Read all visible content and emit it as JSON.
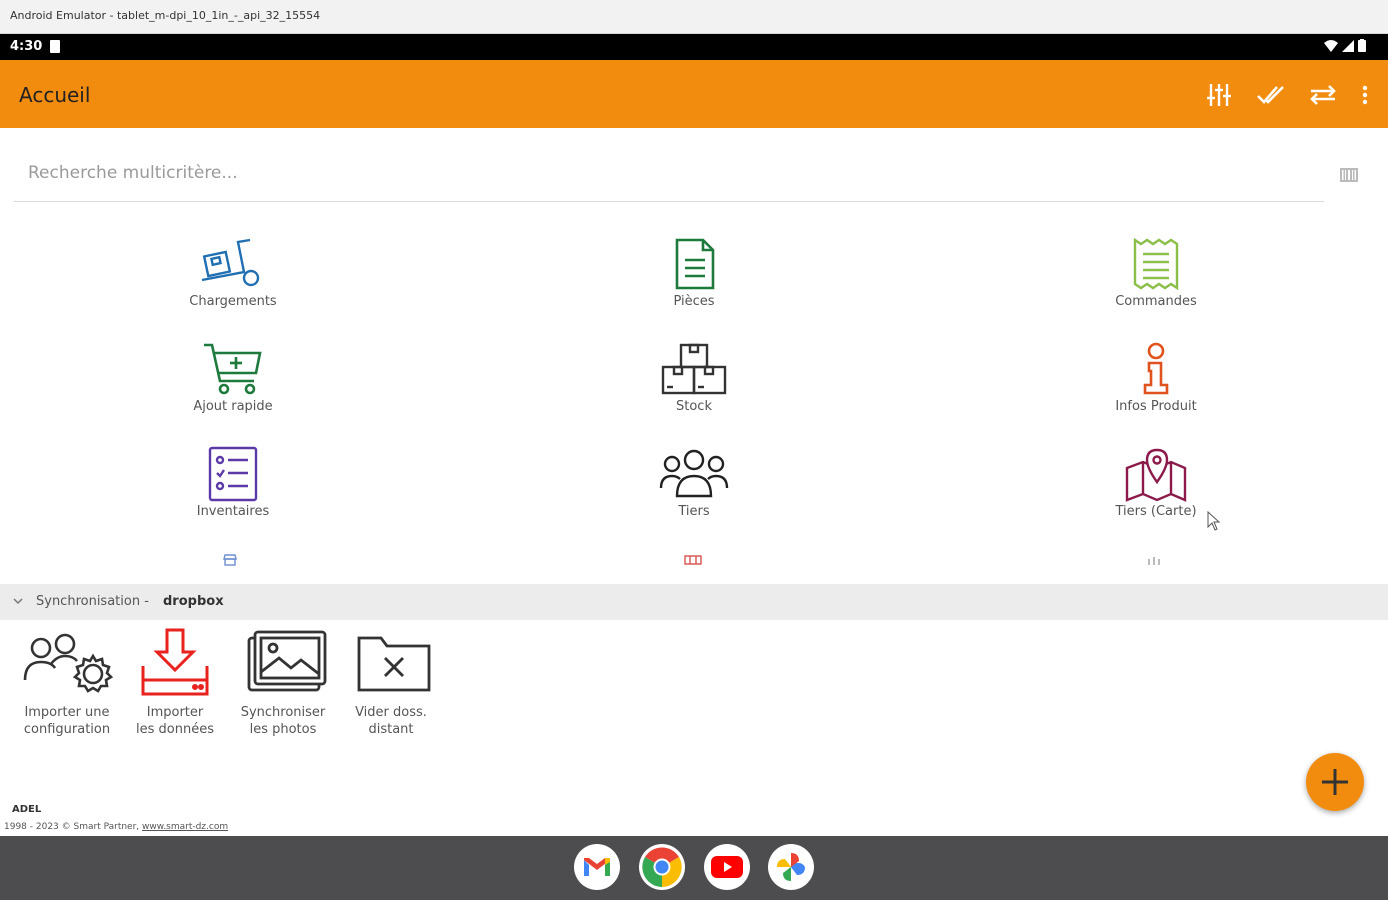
{
  "window": {
    "title": "Android Emulator - tablet_m-dpi_10_1in_-_api_32_15554"
  },
  "statusbar": {
    "time": "4:30"
  },
  "appbar": {
    "title": "Accueil",
    "actions": [
      "filter-settings",
      "done-all",
      "sync-arrows",
      "more-vertical"
    ],
    "color": "#f28c0f"
  },
  "search": {
    "placeholder": "Recherche multicritère..."
  },
  "tiles": [
    {
      "label": "Chargements",
      "icon": "hand-truck-icon",
      "color": "#1f6fb2"
    },
    {
      "label": "Pièces",
      "icon": "document-icon",
      "color": "#1e7a3c"
    },
    {
      "label": "Commandes",
      "icon": "receipt-icon",
      "color": "#8bbf4a"
    },
    {
      "label": "Ajout rapide",
      "icon": "cart-plus-icon",
      "color": "#1e7a3c"
    },
    {
      "label": "Stock",
      "icon": "boxes-icon",
      "color": "#333333"
    },
    {
      "label": "Infos Produit",
      "icon": "info-icon",
      "color": "#e0531f"
    },
    {
      "label": "Inventaires",
      "icon": "checklist-icon",
      "color": "#5b3aa8"
    },
    {
      "label": "Tiers",
      "icon": "people-icon",
      "color": "#222222"
    },
    {
      "label": "Tiers (Carte)",
      "icon": "map-pin-icon",
      "color": "#8b1a4a"
    }
  ],
  "sync": {
    "label": "Synchronisation -",
    "provider": "dropbox",
    "items": [
      {
        "line1": "Importer une",
        "line2": "configuration",
        "icon": "users-gear-icon"
      },
      {
        "line1": "Importer",
        "line2": "les données",
        "icon": "download-tray-icon"
      },
      {
        "line1": "Synchroniser",
        "line2": "les photos",
        "icon": "photos-icon"
      },
      {
        "line1": "Vider doss.",
        "line2": "distant",
        "icon": "folder-x-icon"
      }
    ]
  },
  "footer": {
    "brand": "ADEL",
    "copyright": "1998 - 2023 © Smart Partner,",
    "link": "www.smart-dz.com"
  },
  "dock": {
    "apps": [
      "gmail-icon",
      "chrome-icon",
      "youtube-icon",
      "photos-app-icon"
    ]
  }
}
